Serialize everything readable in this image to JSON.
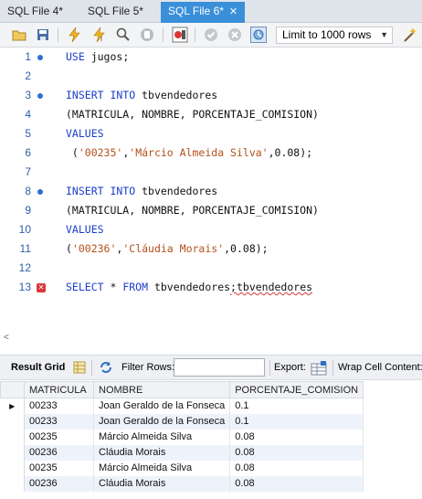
{
  "tabs": [
    {
      "label": "SQL File 4*",
      "active": false,
      "closable": false
    },
    {
      "label": "SQL File 5*",
      "active": false,
      "closable": false
    },
    {
      "label": "SQL File 6*",
      "active": true,
      "closable": true
    }
  ],
  "toolbar": {
    "icons": [
      "open-folder-icon",
      "save-icon",
      "execute-icon",
      "execute-current-icon",
      "explain-icon",
      "stop-icon",
      "toggle-output-icon",
      "commit-icon",
      "rollback-icon",
      "auto-commit-icon"
    ],
    "limit_label": "Limit to 1000 rows",
    "extra_icons": [
      "beautify-icon"
    ]
  },
  "editor": {
    "lines": [
      {
        "n": "1",
        "marker": "dot",
        "tokens": [
          {
            "t": "USE",
            "c": "kw"
          },
          {
            "t": " jugos;",
            "c": ""
          }
        ]
      },
      {
        "n": "2",
        "marker": "",
        "tokens": []
      },
      {
        "n": "3",
        "marker": "dot",
        "tokens": [
          {
            "t": "INSERT INTO",
            "c": "kw"
          },
          {
            "t": " tbvendedores",
            "c": ""
          }
        ]
      },
      {
        "n": "4",
        "marker": "",
        "tokens": [
          {
            "t": "(MATRICULA, NOMBRE, PORCENTAJE_COMISION)",
            "c": ""
          }
        ]
      },
      {
        "n": "5",
        "marker": "",
        "tokens": [
          {
            "t": "VALUES",
            "c": "kw"
          }
        ]
      },
      {
        "n": "6",
        "marker": "",
        "tokens": [
          {
            "t": " (",
            "c": ""
          },
          {
            "t": "'00235'",
            "c": "str"
          },
          {
            "t": ",",
            "c": ""
          },
          {
            "t": "'Márcio Almeida Silva'",
            "c": "str"
          },
          {
            "t": ",0.08);",
            "c": ""
          }
        ]
      },
      {
        "n": "7",
        "marker": "",
        "tokens": []
      },
      {
        "n": "8",
        "marker": "dot",
        "tokens": [
          {
            "t": "INSERT INTO",
            "c": "kw"
          },
          {
            "t": " tbvendedores",
            "c": ""
          }
        ]
      },
      {
        "n": "9",
        "marker": "",
        "tokens": [
          {
            "t": "(MATRICULA, NOMBRE, PORCENTAJE_COMISION)",
            "c": ""
          }
        ]
      },
      {
        "n": "10",
        "marker": "",
        "tokens": [
          {
            "t": "VALUES",
            "c": "kw"
          }
        ]
      },
      {
        "n": "11",
        "marker": "",
        "tokens": [
          {
            "t": "(",
            "c": ""
          },
          {
            "t": "'00236'",
            "c": "str"
          },
          {
            "t": ",",
            "c": ""
          },
          {
            "t": "'Cláudia Morais'",
            "c": "str"
          },
          {
            "t": ",0.08);",
            "c": ""
          }
        ]
      },
      {
        "n": "12",
        "marker": "",
        "tokens": []
      },
      {
        "n": "13",
        "marker": "error",
        "tokens": [
          {
            "t": "SELECT",
            "c": "kw"
          },
          {
            "t": " * ",
            "c": ""
          },
          {
            "t": "FROM",
            "c": "kw"
          },
          {
            "t": " tbvendedores",
            "c": ""
          },
          {
            "t": ";tbvendedores",
            "c": "squiggle"
          }
        ]
      }
    ]
  },
  "result_toolbar": {
    "result_grid_label": "Result Grid",
    "filter_label": "Filter Rows:",
    "filter_value": "",
    "export_label": "Export:",
    "wrap_label": "Wrap Cell Content:"
  },
  "grid": {
    "columns": [
      "MATRICULA",
      "NOMBRE",
      "PORCENTAJE_COMISION"
    ],
    "rows": [
      [
        "00233",
        "Joan Geraldo de la Fonseca",
        "0.1"
      ],
      [
        "00233",
        "Joan Geraldo de la Fonseca",
        "0.1"
      ],
      [
        "00235",
        "Márcio Almeida Silva",
        "0.08"
      ],
      [
        "00236",
        "Cláudia Morais",
        "0.08"
      ],
      [
        "00235",
        "Márcio Almeida Silva",
        "0.08"
      ],
      [
        "00236",
        "Cláudia Morais",
        "0.08"
      ]
    ],
    "current_row": 0
  }
}
